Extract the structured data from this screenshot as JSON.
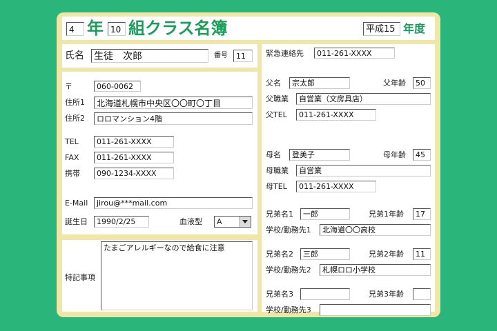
{
  "header": {
    "grade_value": "4",
    "grade_label": "年",
    "class_value": "10",
    "title": "組クラス名簿",
    "era_value": "平成15",
    "year_label": "年度"
  },
  "name_section": {
    "name_label": "氏名",
    "name_value": "生徒　次郎",
    "number_label": "番号",
    "number_value": "11"
  },
  "address_section": {
    "postal_label": "〒",
    "postal_value": "060-0062",
    "address1_label": "住所1",
    "address1_value": "北海道札幌市中央区〇〇町〇丁目",
    "address2_label": "住所2",
    "address2_value": "ロロマンション4階",
    "tel_label": "TEL",
    "tel_value": "011-261-XXXX",
    "fax_label": "FAX",
    "fax_value": "011-261-XXXX",
    "mobile_label": "携帯",
    "mobile_value": "090-1234-XXXX",
    "email_label": "E-Mail",
    "email_value": "jirou@***mail.com",
    "birthday_label": "誕生日",
    "birthday_value": "1990/2/25",
    "blood_label": "血液型",
    "blood_value": "A"
  },
  "notes_section": {
    "label": "特記事項",
    "value": "たまごアレルギーなので給食に注意"
  },
  "family_section": {
    "emergency_label": "緊急連絡先",
    "emergency_value": "011-261-XXXX",
    "father_name_label": "父名",
    "father_name_value": "宗太郎",
    "father_age_label": "父年齢",
    "father_age_value": "50",
    "father_job_label": "父職業",
    "father_job_value": "自営業（文房具店）",
    "father_tel_label": "父TEL",
    "father_tel_value": "011-261-XXXX",
    "mother_name_label": "母名",
    "mother_name_value": "登美子",
    "mother_age_label": "母年齢",
    "mother_age_value": "45",
    "mother_job_label": "母職業",
    "mother_job_value": "自営業",
    "mother_tel_label": "母TEL",
    "mother_tel_value": "011-261-XXXX",
    "sib1_name_label": "兄弟名1",
    "sib1_name_value": "一郎",
    "sib1_age_label": "兄弟1年齢",
    "sib1_age_value": "17",
    "sib1_school_label": "学校/勤務先1",
    "sib1_school_value": "北海道〇〇高校",
    "sib2_name_label": "兄弟名2",
    "sib2_name_value": "三郎",
    "sib2_age_label": "兄弟2年齢",
    "sib2_age_value": "11",
    "sib2_school_label": "学校/勤務先2",
    "sib2_school_value": "札幌ロロ小学校",
    "sib3_name_label": "兄弟名3",
    "sib3_name_value": "",
    "sib3_age_label": "兄弟3年齢",
    "sib3_age_value": "",
    "sib3_school_label": "学校/勤務先3",
    "sib3_school_value": ""
  }
}
